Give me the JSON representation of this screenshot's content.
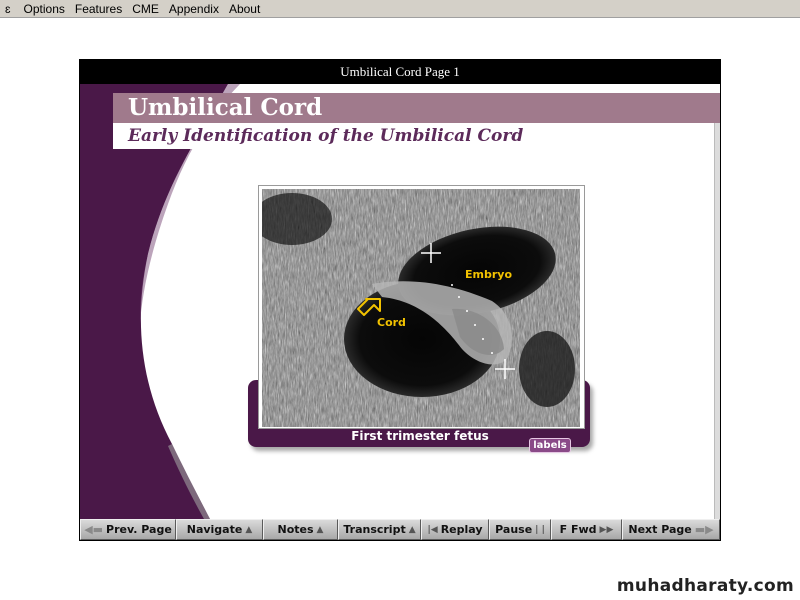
{
  "menubar": {
    "logo": "ɛ",
    "items": [
      "Options",
      "Features",
      "CME",
      "Appendix",
      "About"
    ]
  },
  "window": {
    "title": "Umbilical Cord Page 1"
  },
  "header": {
    "title": "Umbilical Cord",
    "subtitle": "Early Identification of the Umbilical Cord"
  },
  "figure": {
    "label_embryo": "Embryo",
    "label_cord": "Cord",
    "caption": "First trimester fetus",
    "labels_button": "labels"
  },
  "toolbar": {
    "prev": "Prev. Page",
    "navigate": "Navigate",
    "notes": "Notes",
    "transcript": "Transcript",
    "replay": "Replay",
    "pause": "Pause",
    "ffwd": "F Fwd",
    "next": "Next Page"
  },
  "watermark": "muhadharaty.com",
  "colors": {
    "accent_purple": "#4a1848",
    "title_band": "#a07a8c",
    "subtitle_text": "#5c2a5a",
    "label_yellow": "#f2c200"
  }
}
